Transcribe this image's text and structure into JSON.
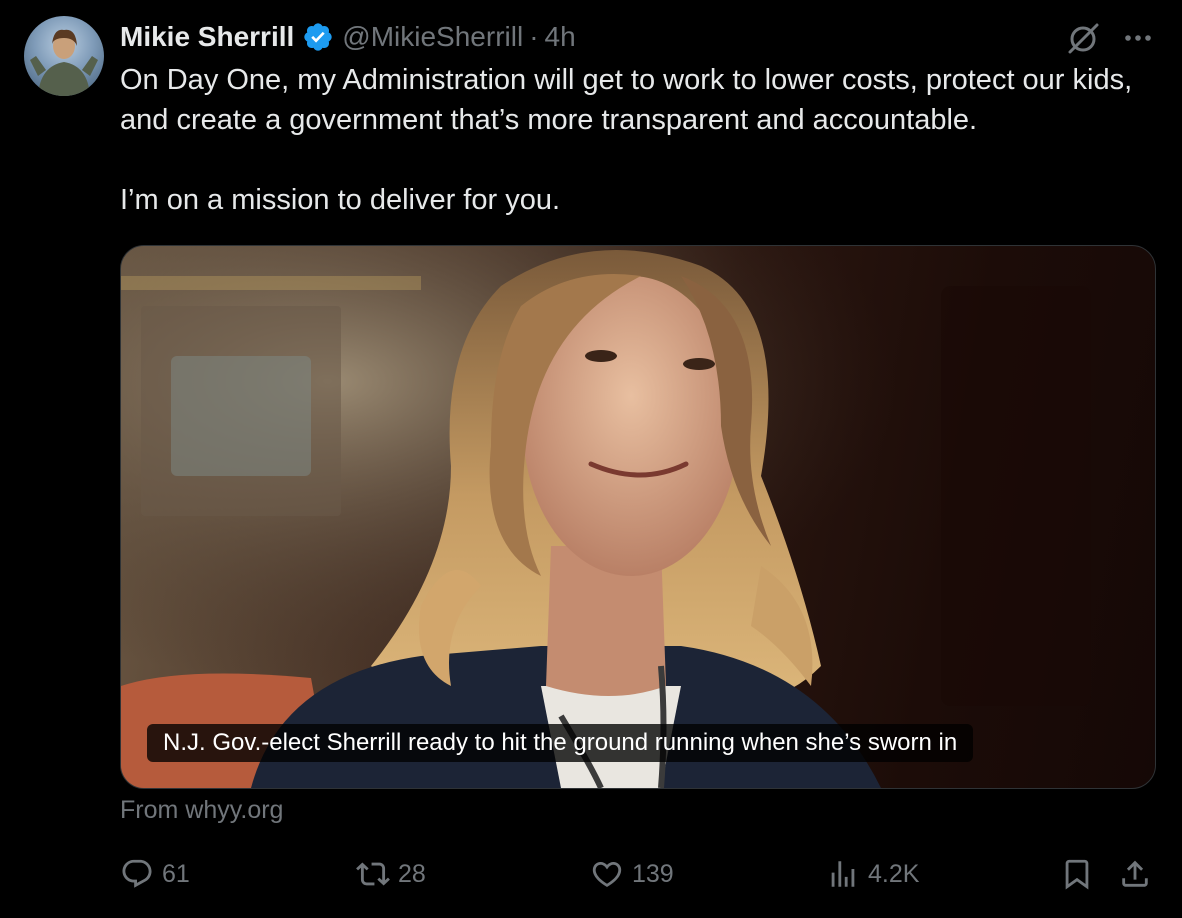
{
  "author": {
    "name": "Mikie Sherrill",
    "handle": "@MikieSherrill",
    "separator": "·",
    "time": "4h",
    "verified": true
  },
  "tweet": {
    "line1": "On Day One, my Administration will get to work to lower costs, protect our kids, and create a government that’s more transparent and accountable.",
    "line2": "I’m on a mission to deliver for you."
  },
  "card": {
    "caption": "N.J. Gov.-elect Sherrill ready to hit the ground running when she’s sworn in",
    "source": "From whyy.org"
  },
  "stats": {
    "replies": "61",
    "reposts": "28",
    "likes": "139",
    "views": "4.2K"
  },
  "colors": {
    "background": "#000000",
    "text": "#e7e9ea",
    "muted": "#71767b",
    "verified_badge": "#1d9bf0"
  },
  "icons": [
    "verified-badge-icon",
    "grok-icon",
    "more-icon",
    "reply-icon",
    "repost-icon",
    "like-icon",
    "views-icon",
    "bookmark-icon",
    "share-icon"
  ]
}
